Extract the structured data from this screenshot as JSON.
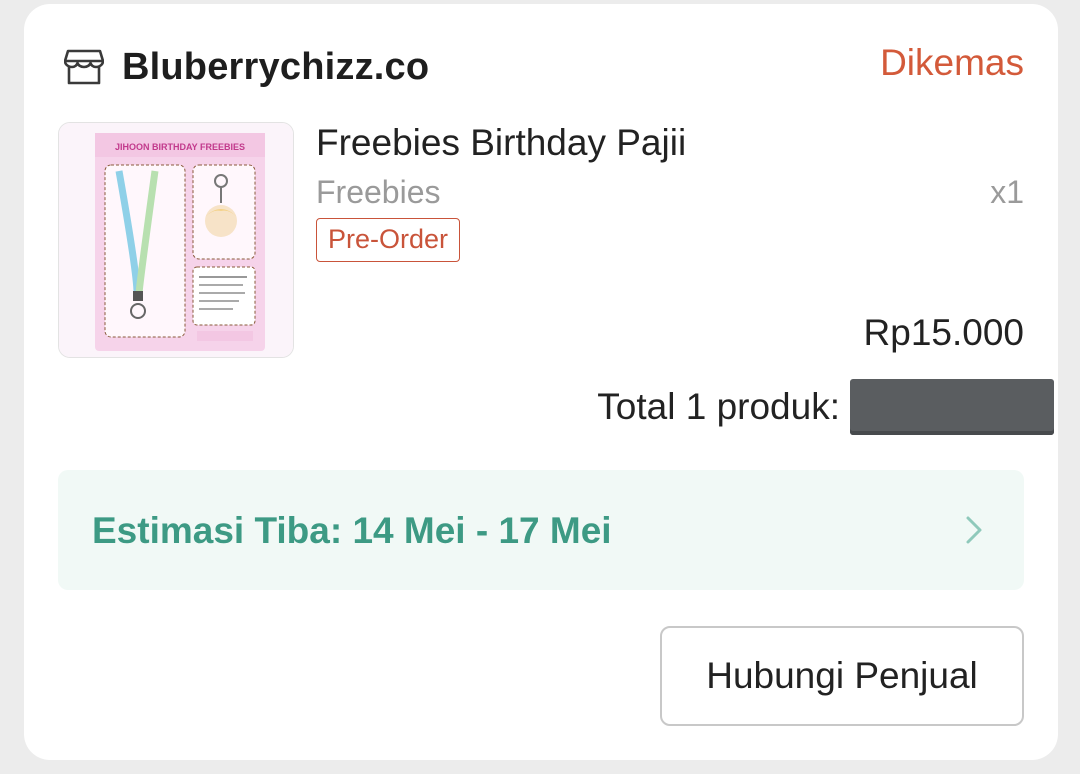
{
  "shop": {
    "name": "Bluberrychizz.co",
    "icon": "store-icon"
  },
  "order": {
    "status": "Dikemas"
  },
  "product": {
    "name": "Freebies Birthday Pajii",
    "variant": "Freebies",
    "quantity": "x1",
    "badge": "Pre-Order",
    "price": "Rp15.000",
    "image": {
      "title": "JIHOON BIRTHDAY FREEBIES"
    }
  },
  "total": {
    "label": "Total 1 produk:",
    "value": ""
  },
  "eta": {
    "text": "Estimasi Tiba: 14 Mei - 17 Mei",
    "icon": "chevron-right-icon"
  },
  "actions": {
    "contact_seller": "Hubungi Penjual"
  },
  "colors": {
    "status": "#d35a3a",
    "eta_text": "#3d9a84",
    "eta_bg": "#f1f9f6",
    "badge": "#c9543a"
  }
}
